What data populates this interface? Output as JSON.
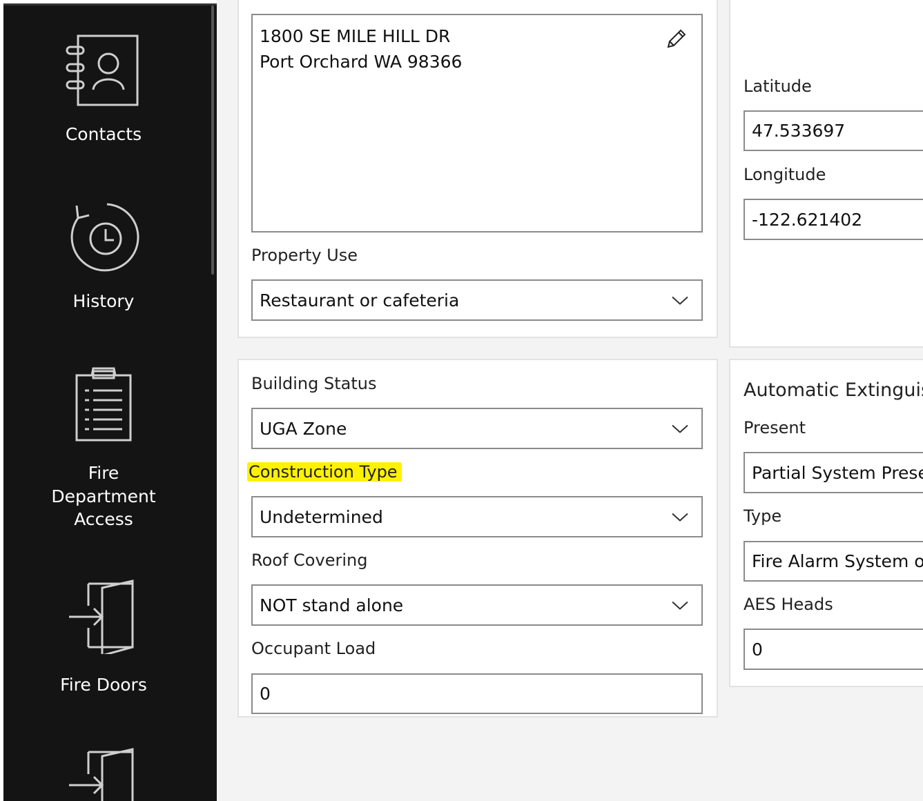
{
  "sidebar": {
    "items": [
      {
        "label": "Contacts",
        "icon": "contacts-icon"
      },
      {
        "label": "History",
        "icon": "history-icon"
      },
      {
        "label_lines": [
          "Fire",
          "Department",
          "Access"
        ],
        "icon": "clipboard-icon"
      },
      {
        "label": "Fire Doors",
        "icon": "door-enter-icon"
      },
      {
        "icon": "door-enter-icon"
      }
    ]
  },
  "address": {
    "line1": "1800 SE MILE HILL DR",
    "line2": "Port Orchard WA 98366"
  },
  "property_use": {
    "label": "Property Use",
    "value": "Restaurant or cafeteria"
  },
  "coordinates": {
    "latitude_label": "Latitude",
    "latitude": "47.533697",
    "longitude_label": "Longitude",
    "longitude": "-122.621402"
  },
  "building": {
    "status_label": "Building Status",
    "status_value": "UGA Zone",
    "construction_label": "Construction Type",
    "construction_value": "Undetermined",
    "roof_label": "Roof Covering",
    "roof_value": "NOT stand alone",
    "occupant_label": "Occupant Load",
    "occupant_value": "0"
  },
  "aes": {
    "title": "Automatic Extinguis",
    "present_label": "Present",
    "present_value": "Partial System Preser",
    "type_label": "Type",
    "type_value": "Fire Alarm System or",
    "heads_label": "AES Heads",
    "heads_value": "0"
  },
  "colors": {
    "sidebar_bg": "#141414",
    "highlight": "#fff200"
  }
}
